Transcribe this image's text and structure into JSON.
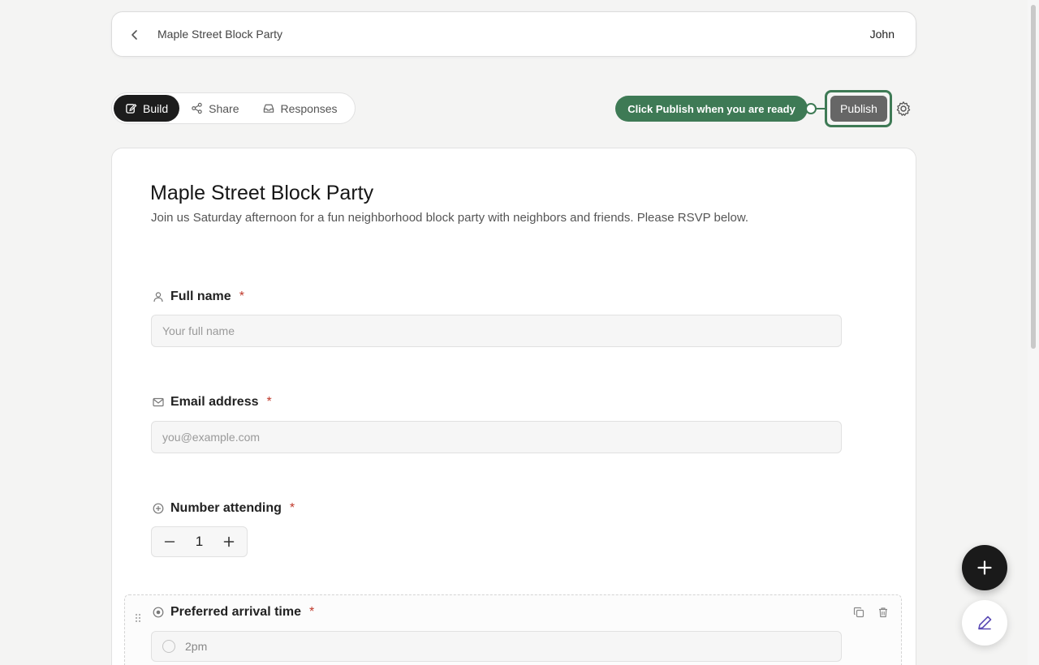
{
  "topbar": {
    "back_icon": "chevron-left-icon",
    "title": "Maple Street Block Party",
    "user": "John"
  },
  "tabs": [
    {
      "label": "Build",
      "icon": "edit-icon",
      "active": true
    },
    {
      "label": "Share",
      "icon": "share-icon",
      "active": false
    },
    {
      "label": "Responses",
      "icon": "inbox-icon",
      "active": false
    }
  ],
  "tooltip": {
    "text": "Click Publish when you are ready"
  },
  "publish": {
    "label": "Publish"
  },
  "form": {
    "title": "Maple Street Block Party",
    "description": "Join us Saturday afternoon for a fun neighborhood block party with neighbors and friends. Please RSVP below.",
    "fields": {
      "full_name": {
        "label": "Full name",
        "required": "*",
        "placeholder": "Your full name",
        "icon": "user-icon"
      },
      "email": {
        "label": "Email address",
        "required": "*",
        "placeholder": "you@example.com",
        "icon": "mail-icon"
      },
      "number": {
        "label": "Number attending",
        "required": "*",
        "value": "1",
        "icon": "plus-circle-icon"
      },
      "arrival": {
        "label": "Preferred arrival time",
        "required": "*",
        "icon": "radio-icon",
        "options": [
          "2pm"
        ]
      }
    }
  },
  "colors": {
    "accent_green": "#3e7a55",
    "dark": "#1c1c1c",
    "required": "#c0392b"
  }
}
